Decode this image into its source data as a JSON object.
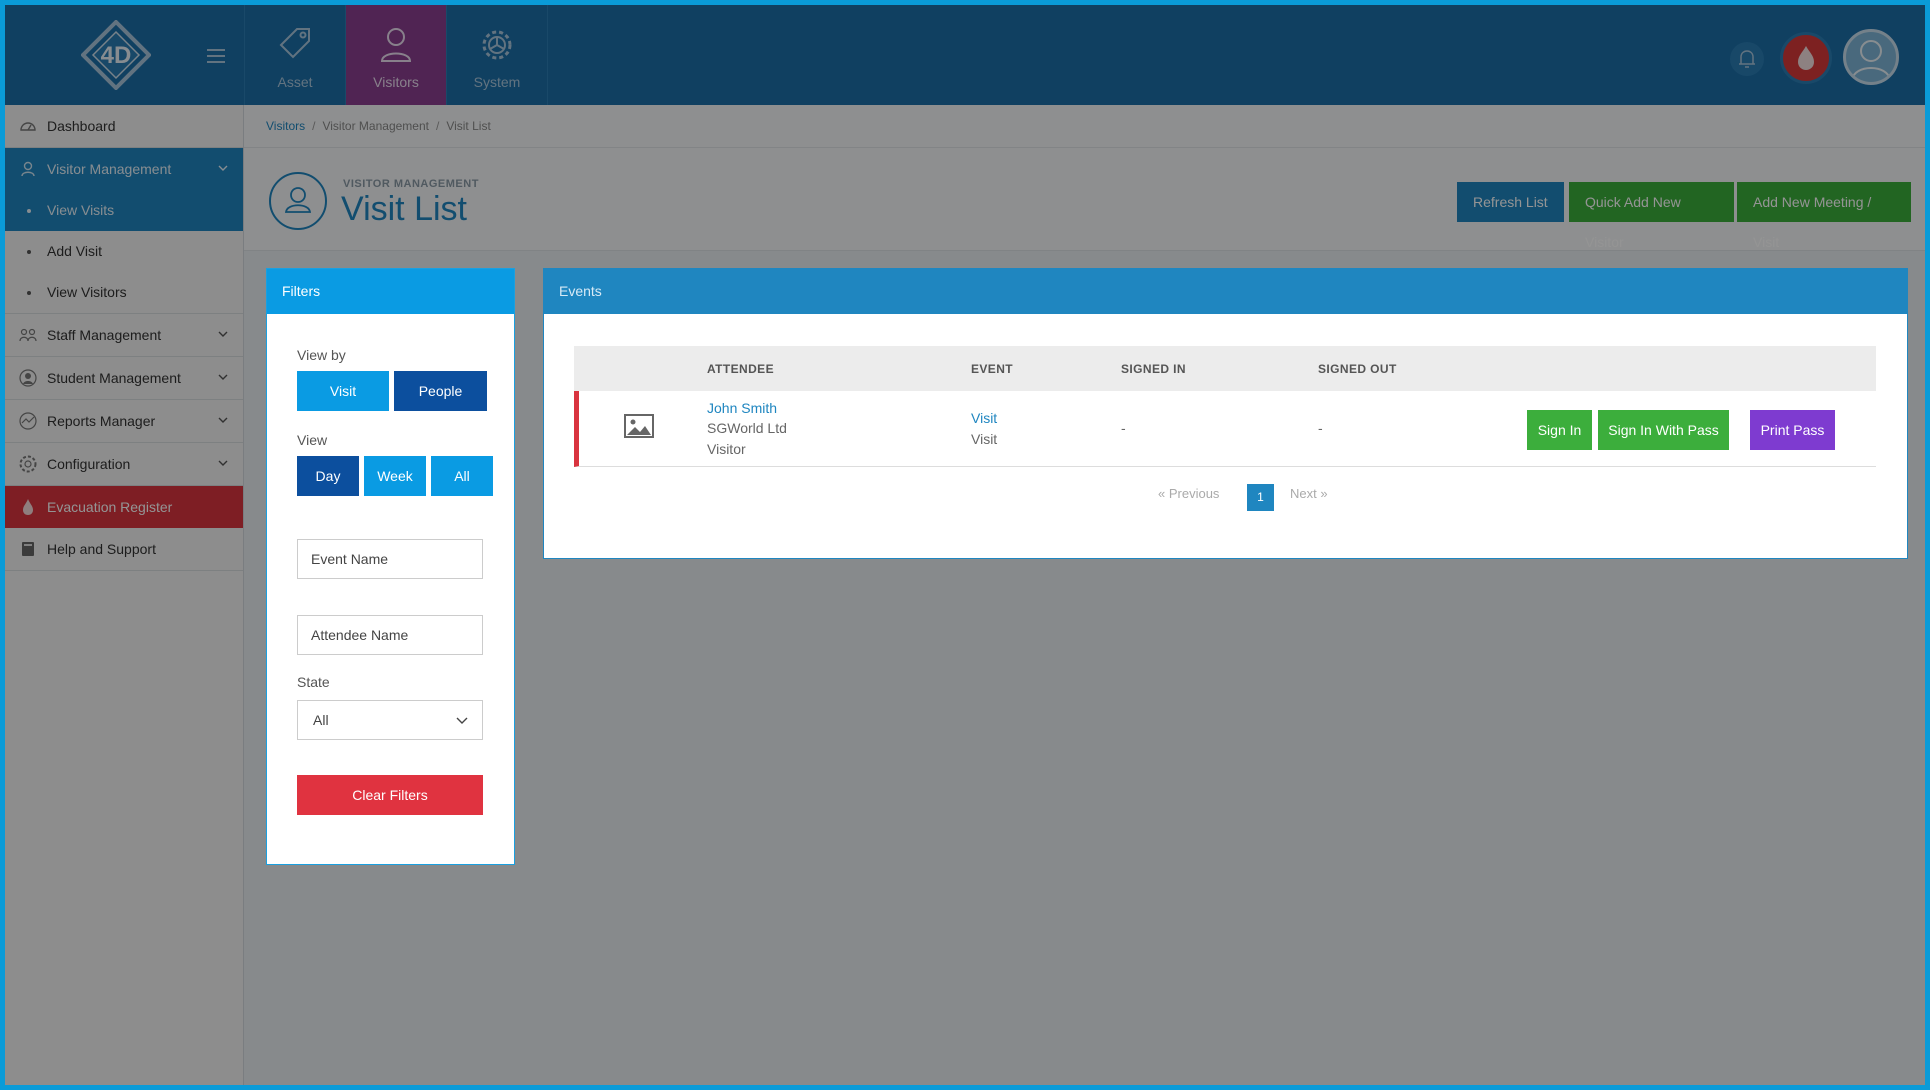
{
  "header": {
    "logo_text": "4D",
    "tabs": [
      {
        "label": "Asset",
        "icon": "tag-icon"
      },
      {
        "label": "Visitors",
        "icon": "person-icon"
      },
      {
        "label": "System",
        "icon": "gear-icon"
      }
    ]
  },
  "sidebar": {
    "dashboard": "Dashboard",
    "visitor_management": "Visitor Management",
    "visitor_sub": [
      "View Visits",
      "Add Visit",
      "View Visitors"
    ],
    "staff_management": "Staff Management",
    "student_management": "Student Management",
    "reports_manager": "Reports Manager",
    "configuration": "Configuration",
    "evacuation_register": "Evacuation Register",
    "help_and_support": "Help and Support"
  },
  "breadcrumb": [
    "Visitors",
    "Visitor Management",
    "Visit List"
  ],
  "page": {
    "subtitle": "VISITOR MANAGEMENT",
    "title": "Visit List",
    "buttons": {
      "refresh": "Refresh List",
      "quick_add": "Quick Add New Visitor",
      "add_meeting": "Add New Meeting / Visit"
    }
  },
  "filters": {
    "title": "Filters",
    "view_by_label": "View by",
    "view_by_options": [
      "Visit",
      "People"
    ],
    "view_label": "View",
    "view_options": [
      "Day",
      "Week",
      "All"
    ],
    "event_name_placeholder": "Event Name",
    "attendee_name_placeholder": "Attendee Name",
    "state_label": "State",
    "state_value": "All",
    "clear_button": "Clear Filters"
  },
  "events": {
    "title": "Events",
    "columns": [
      "ATTENDEE",
      "EVENT",
      "SIGNED IN",
      "SIGNED OUT"
    ],
    "rows": [
      {
        "attendee_name": "John Smith",
        "company": "SGWorld Ltd",
        "type": "Visitor",
        "event_link": "Visit",
        "event_type": "Visit",
        "signed_in": "-",
        "signed_out": "-",
        "actions": [
          "Sign In",
          "Sign In With Pass",
          "Print Pass"
        ]
      }
    ],
    "pager": {
      "previous": "«   Previous",
      "current": "1",
      "next": "Next   »"
    }
  },
  "colors": {
    "brand_blue": "#1f86c0",
    "success_green": "#3cae3c",
    "danger_red": "#d9343f",
    "print_purple": "#7e3bd0"
  }
}
